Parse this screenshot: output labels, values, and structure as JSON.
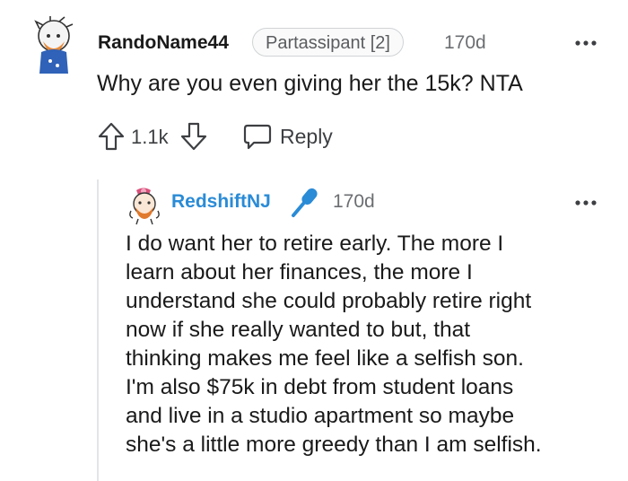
{
  "comment": {
    "username": "RandoName44",
    "flair": "Partassipant [2]",
    "age": "170d",
    "text": "Why are you even giving her the 15k? NTA",
    "score": "1.1k",
    "reply_label": "Reply"
  },
  "reply": {
    "username": "RedshiftNJ",
    "age": "170d",
    "lines": [
      "I do want her to retire early. The more I",
      "learn about her finances, the more I",
      "understand she could probably retire right",
      "now if she really wanted to but, that",
      "thinking makes me feel like a selfish son.",
      "I'm also $75k in debt from student loans",
      "and live in a studio apartment so maybe",
      "she's a little more greedy than I am selfish."
    ]
  },
  "colors": {
    "username_reply": "#2a8bd6",
    "mic_icon": "#2a8bd6",
    "meta_text": "#6b6e71",
    "thread_line": "#e3e5e8"
  },
  "icons": [
    "avatar",
    "more-options-icon",
    "upvote-icon",
    "downvote-icon",
    "comment-bubble-icon",
    "microphone-icon"
  ]
}
